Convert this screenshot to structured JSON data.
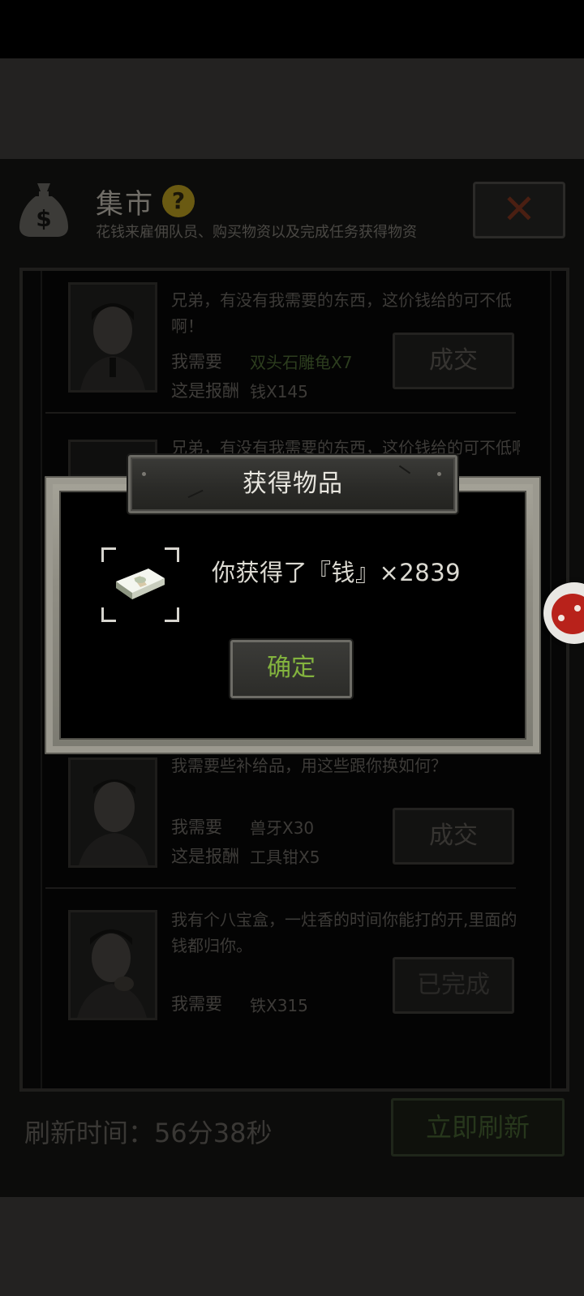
{
  "market": {
    "title": "集市",
    "subtitle": "花钱来雇佣队员、购买物资以及完成任务获得物资",
    "close_icon": "close-x-icon",
    "bag_icon": "money-bag-icon",
    "help_icon": "question-icon",
    "help_label": "?"
  },
  "trades": [
    {
      "speech": "兄弟，有没有我需要的东西，这价钱给的可不低啊！",
      "need_label": "我需要",
      "need_value": "双头石雕龟X7",
      "reward_label": "这是报酬",
      "reward_value": "钱X145",
      "button": "成交"
    },
    {
      "speech": "兄弟，有没有我需要的东西，这价钱给的可不低啊！"
    },
    {
      "speech": "我需要些补给品，用这些跟你换如何？",
      "need_label": "我需要",
      "need_value": "兽牙X30",
      "reward_label": "这是报酬",
      "reward_value": "工具钳X5",
      "button": "成交"
    },
    {
      "speech": "我有个八宝盒，一炷香的时间你能打的开,里面的钱都归你。",
      "need_label": "我需要",
      "need_value": "铁X315",
      "button": "已完成"
    }
  ],
  "footer": {
    "refresh_time": "刷新时间：56分38秒",
    "refresh_button": "立即刷新"
  },
  "dialog": {
    "title": "获得物品",
    "message": "你获得了『钱』×2839",
    "confirm": "确定",
    "item_icon": "cash-stack-icon"
  },
  "colors": {
    "confirm_text": "#83b33e",
    "frame": "#9b998f"
  }
}
